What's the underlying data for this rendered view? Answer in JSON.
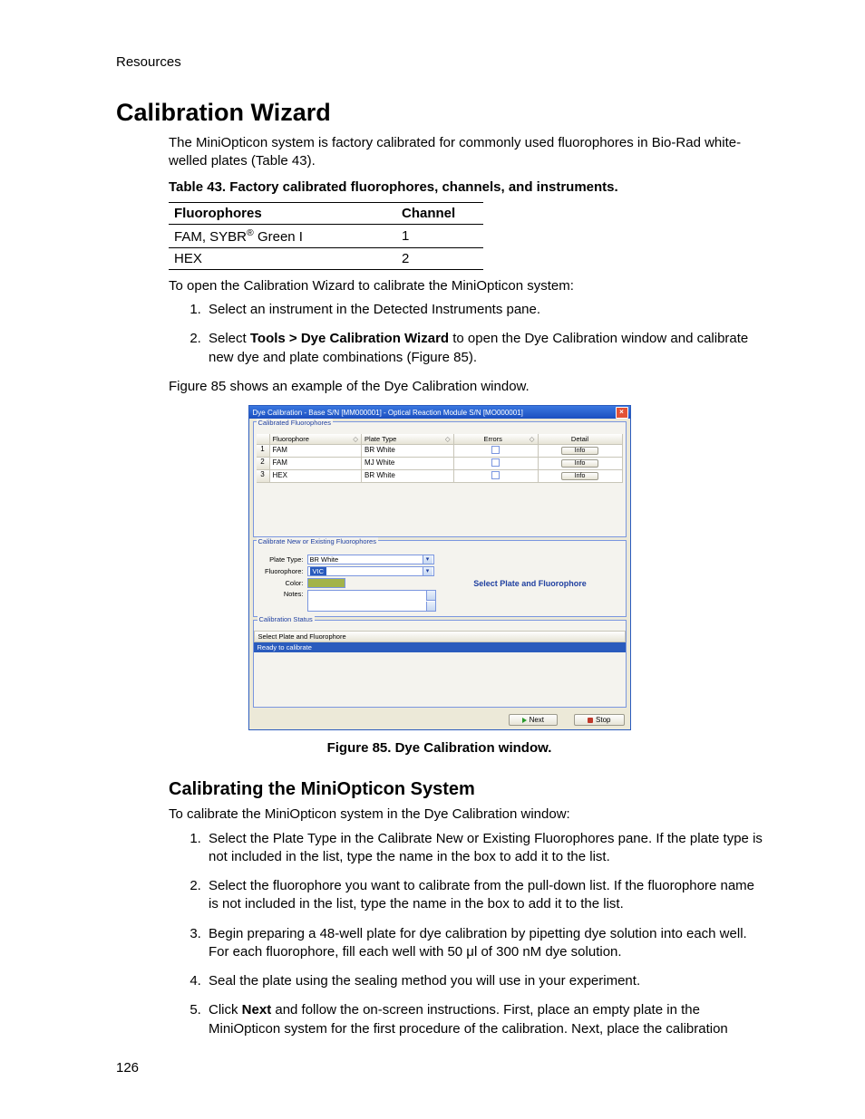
{
  "running_head": "Resources",
  "page_number": "126",
  "h1": "Calibration Wizard",
  "intro": "The MiniOpticon system is factory calibrated for commonly used fluorophores in Bio-Rad white-welled plates (Table 43).",
  "table_caption": "Table 43. Factory calibrated fluorophores, channels, and instruments.",
  "table_headers": {
    "c1": "Fluorophores",
    "c2": "Channel"
  },
  "table_rows": [
    {
      "c1_pre": "FAM, SYBR",
      "c1_sup": "®",
      "c1_post": " Green I",
      "c2": "1"
    },
    {
      "c1_pre": "HEX",
      "c1_sup": "",
      "c1_post": "",
      "c2": "2"
    }
  ],
  "open_intro": "To open the Calibration Wizard to calibrate the MiniOpticon system:",
  "open_steps": {
    "s1": "Select an instrument in the Detected Instruments pane.",
    "s2_pre": "Select ",
    "s2_bold": "Tools > Dye Calibration Wizard",
    "s2_post": " to open the Dye Calibration window and calibrate new dye and plate combinations (Figure 85)."
  },
  "fig_intro": "Figure 85 shows an example of the Dye Calibration window.",
  "figure_caption": "Figure 85. Dye Calibration window.",
  "h2": "Calibrating the MiniOpticon System",
  "cal_intro": "To calibrate the MiniOpticon system in the Dye Calibration window:",
  "cal_steps": {
    "s1": "Select the Plate Type in the Calibrate New or Existing Fluorophores pane. If the plate type is not included in the list, type the name in the box to add it to the list.",
    "s2": "Select the fluorophore you want to calibrate from the pull-down list. If the fluorophore name is not included in the list, type the name in the box to add it to the list.",
    "s3": "Begin preparing a 48-well plate for dye calibration by pipetting dye solution into each well. For each fluorophore, fill each well with 50 μl of 300 nM dye solution.",
    "s4": "Seal the plate using the sealing method you will use in your experiment.",
    "s5_pre": "Click ",
    "s5_bold": "Next",
    "s5_post": " and follow the on-screen instructions. First, place an empty plate in the MiniOpticon system for the first procedure of the calibration. Next, place the calibration"
  },
  "app": {
    "title": "Dye Calibration - Base S/N [MM000001] - Optical Reaction Module S/N [MO000001]",
    "close_glyph": "×",
    "group1_title": "Calibrated Fluorophores",
    "grid": {
      "headers": {
        "fluor": "Fluorophore",
        "plate": "Plate Type",
        "errors": "Errors",
        "detail": "Detail",
        "sort": "◇"
      },
      "rows": [
        {
          "n": "1",
          "fluor": "FAM",
          "plate": "BR White",
          "info": "Info"
        },
        {
          "n": "2",
          "fluor": "FAM",
          "plate": "MJ White",
          "info": "Info"
        },
        {
          "n": "3",
          "fluor": "HEX",
          "plate": "BR White",
          "info": "Info"
        }
      ]
    },
    "group2_title": "Calibrate New or Existing Fluorophores",
    "form": {
      "plate_label": "Plate Type:",
      "plate_value": "BR White",
      "fluor_label": "Fluorophore:",
      "fluor_value": "VIC",
      "color_label": "Color:",
      "notes_label": "Notes:",
      "hint": "Select Plate and Fluorophore"
    },
    "group3_title": "Calibration Status",
    "status": {
      "header": "Select Plate and Fluorophore",
      "row": "Ready to calibrate"
    },
    "buttons": {
      "next": "Next",
      "stop": "Stop"
    }
  }
}
